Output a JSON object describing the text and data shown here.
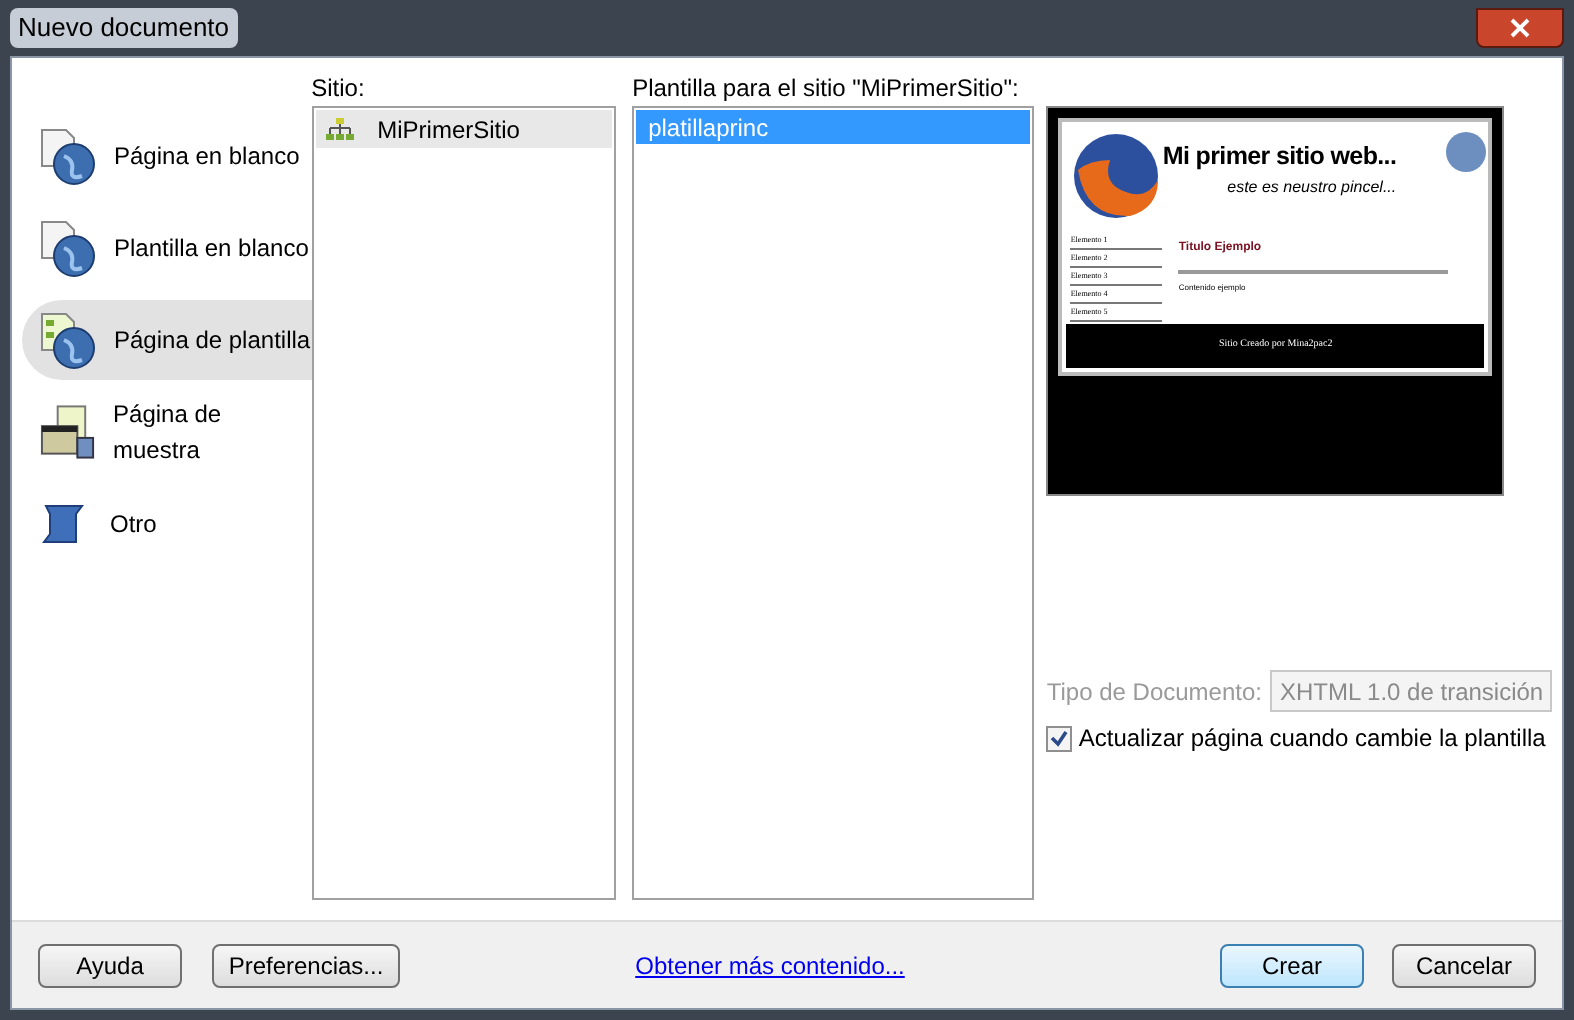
{
  "window": {
    "title": "Nuevo documento"
  },
  "categories": [
    {
      "label": "Página en blanco",
      "kind": "blank",
      "selected": false
    },
    {
      "label": "Plantilla en blanco",
      "kind": "blank",
      "selected": false
    },
    {
      "label": "Página de plantilla",
      "kind": "template",
      "selected": true
    },
    {
      "label": "Página de muestra",
      "kind": "sample",
      "selected": false
    },
    {
      "label": "Otro",
      "kind": "other",
      "selected": false
    }
  ],
  "sites": {
    "label": "Sitio:",
    "items": [
      {
        "label": "MiPrimerSitio",
        "selected": true
      }
    ]
  },
  "templates": {
    "label": "Plantilla para el sitio \"MiPrimerSitio\":",
    "items": [
      {
        "label": "platillaprinc",
        "selected": true
      }
    ]
  },
  "preview": {
    "heading": "Mi primer sitio web...",
    "tagline": "este es neustro pincel...",
    "menu": [
      "Elemento 1",
      "Elemento 2",
      "Elemento 3",
      "Elemento 4",
      "Elemento 5"
    ],
    "title": "Titulo Ejemplo",
    "content": "Contenido ejemplo",
    "footer": "Sitio Creado por Mina2pac2"
  },
  "doctype": {
    "label": "Tipo de Documento:",
    "value": "XHTML 1.0 de transición",
    "disabled": true
  },
  "update_checkbox": {
    "label": "Actualizar página cuando cambie la plantilla",
    "checked": true
  },
  "buttons": {
    "help": "Ayuda",
    "preferences": "Preferencias...",
    "link": "Obtener más contenido...",
    "create": "Crear",
    "cancel": "Cancelar"
  }
}
